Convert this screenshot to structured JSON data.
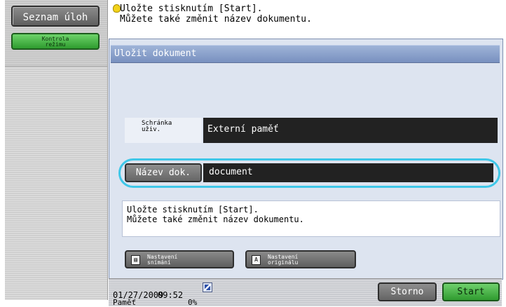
{
  "sidebar": {
    "job_list_label": "Seznam úloh",
    "mode_check_label_line1": "Kontrola",
    "mode_check_label_line2": "režimu"
  },
  "top_message": {
    "line1": "Uložte stisknutím [Start].",
    "line2": "Můžete také změnit název dokumentu."
  },
  "dialog": {
    "title": "Uložit dokument",
    "mailbox": {
      "label_line1": "Schránka",
      "label_line2": "uživ.",
      "value": "Externí paměť"
    },
    "document_name": {
      "button_label": "Název dok.",
      "value": "document"
    },
    "info": {
      "line1": "Uložte stisknutím [Start].",
      "line2": "Můžete také změnit název dokumentu."
    },
    "scan_settings": {
      "line1": "Nastavení",
      "line2": "snímání",
      "icon": "scan-icon"
    },
    "original_settings": {
      "line1": "Nastavení",
      "line2": "originálu",
      "icon_glyph": "A",
      "icon": "original-icon"
    }
  },
  "status_bar": {
    "date": "01/27/2009",
    "time": "09:52",
    "memory_label": "Paměť",
    "memory_value": "0%",
    "network_icon": "network-icon"
  },
  "actions": {
    "cancel_label": "Storno",
    "start_label": "Start"
  },
  "colors": {
    "accent_highlight": "#3fc7e8",
    "start_green": "#2f9b2f",
    "dialog_bg": "#dde4f0",
    "title_bar": "#7890bf"
  }
}
